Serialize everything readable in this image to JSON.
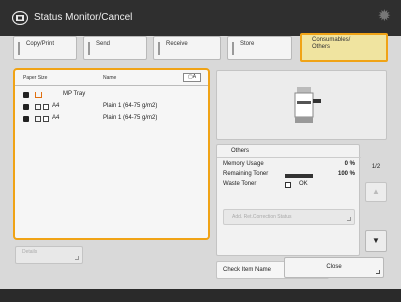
{
  "window": {
    "title": "Status Monitor/Cancel"
  },
  "tabs": [
    {
      "label": "Copy/Print"
    },
    {
      "label": "Send"
    },
    {
      "label": "Receive"
    },
    {
      "label": "Store"
    },
    {
      "label_line1": "Consumables/",
      "label_line2": "Others"
    }
  ],
  "paper_list": {
    "col_size": "Paper Size",
    "col_name": "Name",
    "rows": [
      {
        "size": "MP Tray",
        "name": ""
      },
      {
        "size": "A4",
        "name": "Plain 1 (64-75 g/m2)"
      },
      {
        "size": "A4",
        "name": "Plain 1 (64-75 g/m2)"
      }
    ]
  },
  "details_button": "Details",
  "others": {
    "title": "Others",
    "memory_label": "Memory Usage",
    "memory_value": "0 %",
    "toner_label": "Remaining Toner",
    "toner_value": "100 %",
    "toner_level": 1.0,
    "waste_label": "Waste Toner",
    "waste_value": "OK",
    "add_button": "Add. Ret.Correction Status"
  },
  "pager": {
    "page": "1/2"
  },
  "check_button": "Check Item Name",
  "close_button": "Close"
}
